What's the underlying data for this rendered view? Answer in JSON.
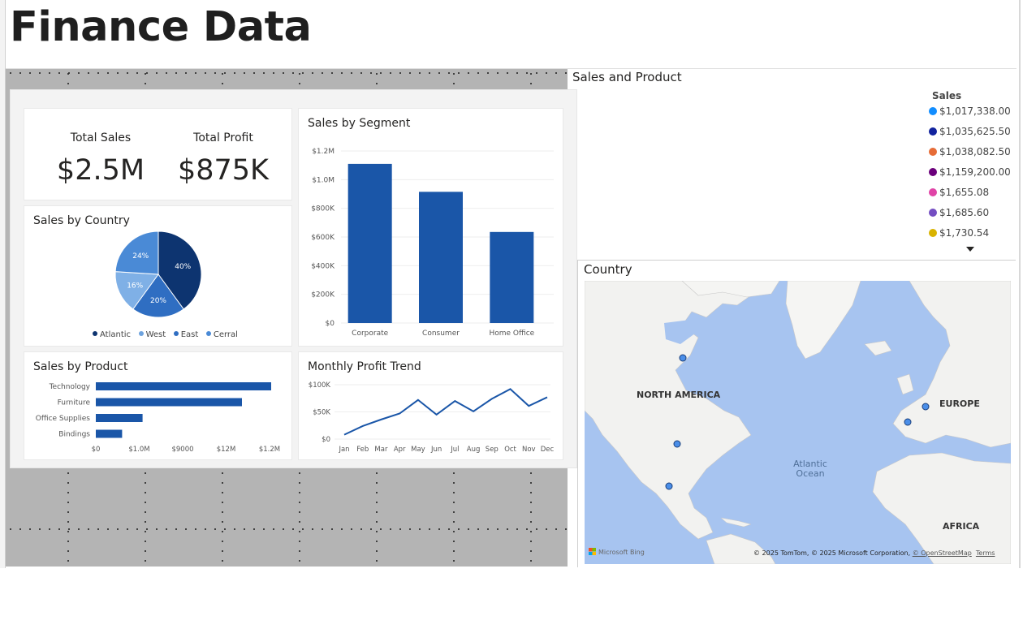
{
  "page": {
    "title": "Finance Data"
  },
  "kpis": {
    "total_sales": {
      "label": "Total Sales",
      "value": "$2.5M"
    },
    "total_profit": {
      "label": "Total Profit",
      "value": "$875K"
    }
  },
  "colors": {
    "accent": "#1a56a8",
    "pie_atlantic": "#0d3470",
    "pie_west": "#6ea3de",
    "pie_east": "#2f6ec2",
    "pie_cerral": "#4a8ad6",
    "canvas_grey": "#b4b4b4",
    "map_water": "#a7c4f0"
  },
  "sales_by_country": {
    "title": "Sales by Country",
    "chart_data": {
      "type": "pie",
      "slices": [
        {
          "label": "40%",
          "value": 40,
          "color": "#0d3470"
        },
        {
          "label": "20%",
          "value": 20,
          "color": "#2f6ec2"
        },
        {
          "label": "16%",
          "value": 16,
          "color": "#7fb0e6"
        },
        {
          "label": "24%",
          "value": 24,
          "color": "#4a8ad6"
        }
      ]
    },
    "legend": [
      {
        "name": "Atlantic",
        "color": "#0d3470"
      },
      {
        "name": "West",
        "color": "#6ea3de"
      },
      {
        "name": "East",
        "color": "#2f6ec2"
      },
      {
        "name": "Cerral",
        "color": "#4a8ad6"
      }
    ]
  },
  "sales_by_segment": {
    "title": "Sales by Segment",
    "chart_data": {
      "type": "bar",
      "categories": [
        "Corporate",
        "Consumer",
        "Home Office"
      ],
      "values": [
        1110000,
        915000,
        635000
      ],
      "ylim": [
        0,
        1200000
      ],
      "yticks": [
        0,
        200000,
        400000,
        600000,
        800000,
        1000000,
        1200000
      ],
      "ytick_labels": [
        "$0",
        "$200K",
        "$400K",
        "$600K",
        "$800K",
        "$1.0M",
        "$1.2M"
      ]
    }
  },
  "sales_by_product": {
    "title": "Sales by Product",
    "chart_data": {
      "type": "bar",
      "orientation": "horizontal",
      "categories": [
        "Technology",
        "Furniture",
        "Office Supplies",
        "Bindings"
      ],
      "values": [
        1.2,
        1.0,
        0.32,
        0.18
      ],
      "xlim": [
        0,
        1.2
      ],
      "xtick_labels": [
        "$0",
        "$1.0M",
        "$9000",
        "$12M",
        "$1.2M"
      ]
    }
  },
  "monthly_profit_trend": {
    "title": "Monthly Profit Trend",
    "chart_data": {
      "type": "line",
      "x": [
        "Jan",
        "Feb",
        "Mar",
        "Apr",
        "May",
        "Jun",
        "Jul",
        "Aug",
        "Sep",
        "Oct",
        "Nov",
        "Dec"
      ],
      "values": [
        8000,
        24000,
        36000,
        47000,
        72000,
        45000,
        70000,
        51000,
        74000,
        92000,
        61000,
        77000
      ],
      "ylim": [
        0,
        100000
      ],
      "yticks": [
        0,
        50000,
        100000
      ],
      "ytick_labels": [
        "$0",
        "$50K",
        "$100K"
      ]
    }
  },
  "sales_and_product": {
    "title": "Sales and Product",
    "legend_header": "Sales",
    "items": [
      {
        "label": "$1,017,338.00",
        "color": "#118dff"
      },
      {
        "label": "$1,035,625.50",
        "color": "#12239e"
      },
      {
        "label": "$1,038,082.50",
        "color": "#e66c37"
      },
      {
        "label": "$1,159,200.00",
        "color": "#6b007b"
      },
      {
        "label": "$1,655.08",
        "color": "#e044a7"
      },
      {
        "label": "$1,685.60",
        "color": "#744ec2"
      },
      {
        "label": "$1,730.54",
        "color": "#d9b300"
      }
    ]
  },
  "map": {
    "title": "Country",
    "labels": {
      "north_america": "NORTH AMERICA",
      "europe": "EUROPE",
      "africa": "AFRICA",
      "ocean_line1": "Atlantic",
      "ocean_line2": "Ocean"
    },
    "bing": "Microsoft Bing",
    "credit": "© 2025 TomTom, © 2025 Microsoft Corporation, ",
    "osm": "© OpenStreetMap",
    "terms": "Terms"
  }
}
